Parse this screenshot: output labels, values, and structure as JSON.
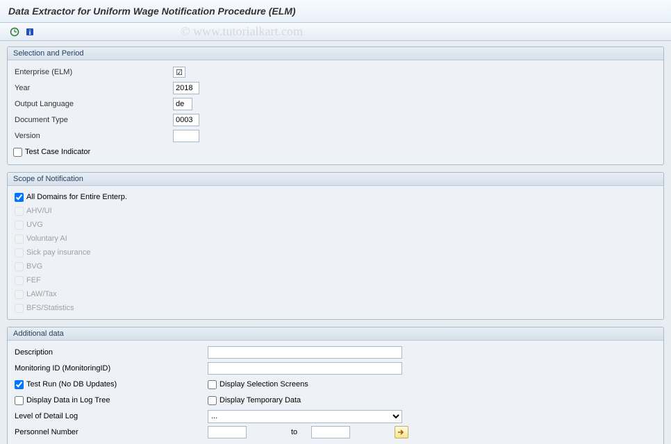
{
  "title": "Data Extractor for Uniform Wage Notification Procedure (ELM)",
  "watermark": "© www.tutorialkart.com",
  "groups": {
    "selection": {
      "header": "Selection and Period",
      "enterprise_label": "Enterprise (ELM)",
      "enterprise_check": "☑",
      "year_label": "Year",
      "year_value": "2018",
      "lang_label": "Output Language",
      "lang_value": "de",
      "doctype_label": "Document Type",
      "doctype_value": "0003",
      "version_label": "Version",
      "version_value": "",
      "testcase_label": "Test Case Indicator"
    },
    "scope": {
      "header": "Scope of Notification",
      "all_label": "All Domains for Entire Enterp.",
      "ahv_label": "AHV/UI",
      "uvg_label": "UVG",
      "voluntary_label": "Voluntary AI",
      "sickpay_label": "Sick pay insurance",
      "bvg_label": "BVG",
      "fef_label": "FEF",
      "lawtax_label": "LAW/Tax",
      "bfs_label": "BFS/Statistics"
    },
    "additional": {
      "header": "Additional data",
      "description_label": "Description",
      "description_value": "",
      "monitoring_label": "Monitoring ID (MonitoringID)",
      "monitoring_value": "",
      "testrun_label": "Test Run (No DB Updates)",
      "display_selection_label": "Display Selection Screens",
      "display_data_log_label": "Display Data in Log Tree",
      "display_temp_label": "Display Temporary Data",
      "detail_log_label": "Level of Detail Log",
      "detail_log_value": "...",
      "personnel_label": "Personnel Number",
      "personnel_from": "",
      "to_label": "to",
      "personnel_to": ""
    }
  }
}
